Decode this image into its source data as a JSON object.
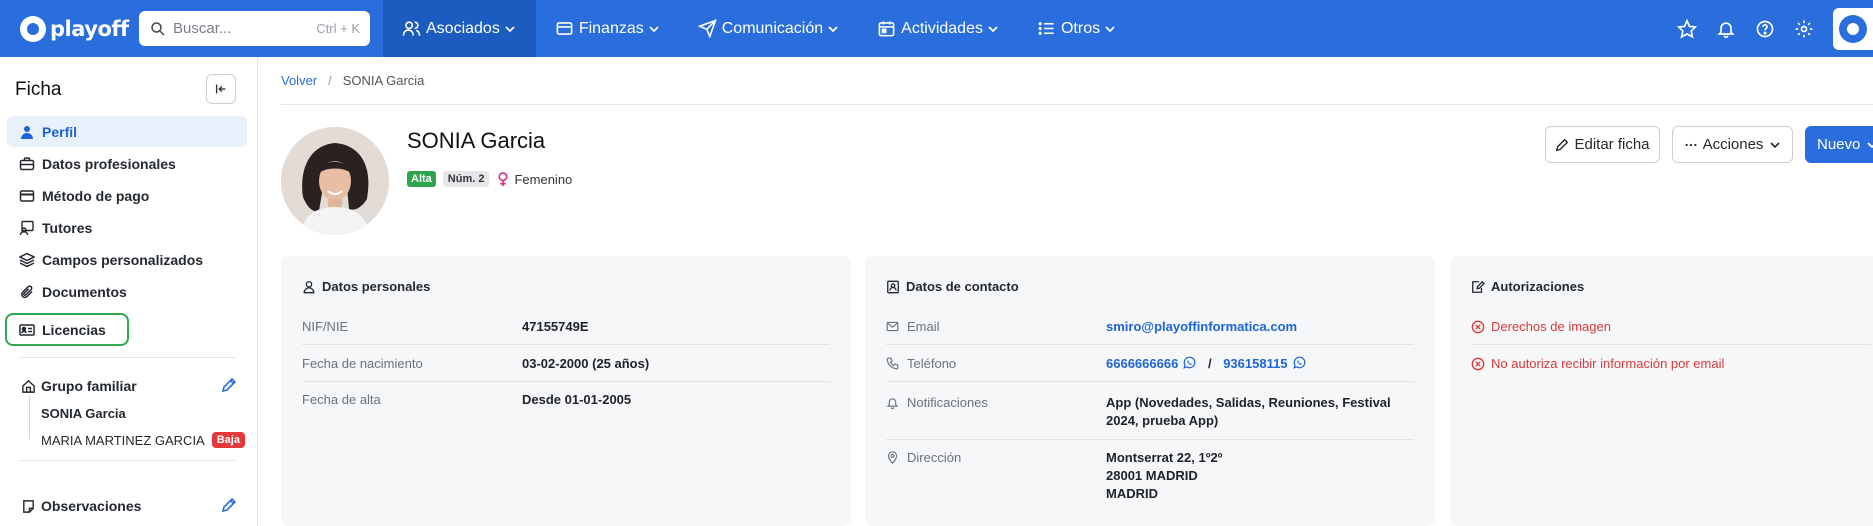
{
  "topbar": {
    "brand": "playoff",
    "search": {
      "placeholder": "Buscar...",
      "shortcut": "Ctrl + K"
    },
    "nav": [
      {
        "label": "Asociados",
        "icon": "users-icon",
        "active": true
      },
      {
        "label": "Finanzas",
        "icon": "wallet-icon"
      },
      {
        "label": "Comunicación",
        "icon": "send-icon"
      },
      {
        "label": "Actividades",
        "icon": "calendar-icon"
      },
      {
        "label": "Otros",
        "icon": "list-icon"
      }
    ],
    "right_icons": [
      "star-icon",
      "bell-icon",
      "help-icon",
      "gear-icon"
    ]
  },
  "sidebar": {
    "title": "Ficha",
    "items": [
      {
        "label": "Perfil",
        "icon": "user-icon",
        "active": true
      },
      {
        "label": "Datos profesionales",
        "icon": "briefcase-icon"
      },
      {
        "label": "Método de pago",
        "icon": "credit-card-icon"
      },
      {
        "label": "Tutores",
        "icon": "tutor-icon"
      },
      {
        "label": "Campos personalizados",
        "icon": "layers-icon"
      },
      {
        "label": "Documentos",
        "icon": "paperclip-icon"
      },
      {
        "label": "Licencias",
        "icon": "id-card-icon",
        "highlighted": true
      }
    ],
    "family_group": {
      "title": "Grupo familiar",
      "members": [
        {
          "name": "SONIA Garcia",
          "current": true
        },
        {
          "name": "MARIA MARTINEZ GARCIA",
          "badge": "Baja"
        }
      ]
    },
    "observations": {
      "title": "Observaciones"
    }
  },
  "breadcrumb": {
    "back": "Volver",
    "current": "SONIA Garcia"
  },
  "profile": {
    "name": "SONIA Garcia",
    "status": "Alta",
    "number": "Núm. 2",
    "gender": "Femenino"
  },
  "actions": {
    "edit": "Editar ficha",
    "actions": "Acciones",
    "new": "Nuevo"
  },
  "personal": {
    "title": "Datos personales",
    "rows": [
      {
        "label": "NIF/NIE",
        "value": "47155749E"
      },
      {
        "label": "Fecha de nacimiento",
        "value": "03-02-2000 (25 años)"
      },
      {
        "label": "Fecha de alta",
        "value": "Desde 01-01-2005"
      }
    ]
  },
  "contact": {
    "title": "Datos de contacto",
    "email_label": "Email",
    "email": "smiro@playoffinformatica.com",
    "phone_label": "Teléfono",
    "phone1": "6666666666",
    "phone_sep": "/",
    "phone2": "936158115",
    "notifications_label": "Notificaciones",
    "notifications": "App (Novedades, Salidas, Reuniones, Festival 2024, prueba App)",
    "address_label": "Dirección",
    "address_lines": [
      "Montserrat 22, 1º2º",
      "28001 MADRID",
      "MADRID"
    ]
  },
  "authorizations": {
    "title": "Autorizaciones",
    "items": [
      "Derechos de imagen",
      "No autoriza recibir información por email"
    ]
  }
}
